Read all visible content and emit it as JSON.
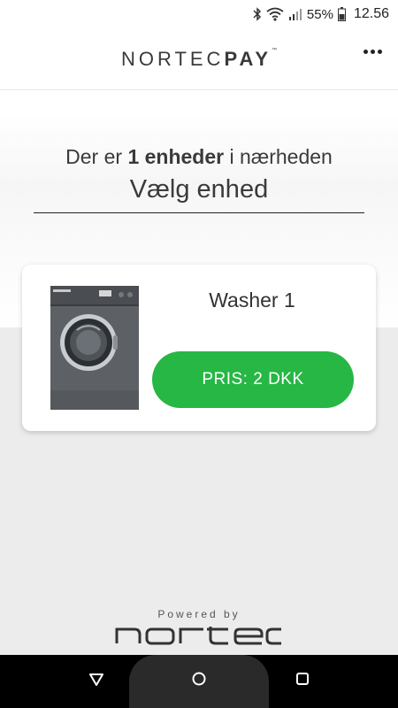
{
  "status_bar": {
    "battery_percent": "55%",
    "time": "12.56",
    "icons": [
      "bluetooth-icon",
      "wifi-icon",
      "signal-icon",
      "battery-icon"
    ]
  },
  "header": {
    "brand_light": "NORTEC",
    "brand_bold": "PAY",
    "brand_tm": "™",
    "menu_icon": "more-icon"
  },
  "intro": {
    "prefix": "Der er ",
    "count_text": "1 enheder",
    "suffix": " i nærheden",
    "select_label": "Vælg enhed"
  },
  "devices": [
    {
      "name": "Washer 1",
      "price_label": "PRIS: 2 DKK",
      "image": "washing-machine"
    }
  ],
  "footer": {
    "powered_by": "Powered by",
    "logo_text": "nortec"
  },
  "nav": {
    "back_icon": "back-triangle-icon",
    "home_icon": "home-circle-icon",
    "recent_icon": "recent-square-icon"
  },
  "colors": {
    "accent_green": "#26b744",
    "background": "#ececec",
    "text_dark": "#333333"
  }
}
